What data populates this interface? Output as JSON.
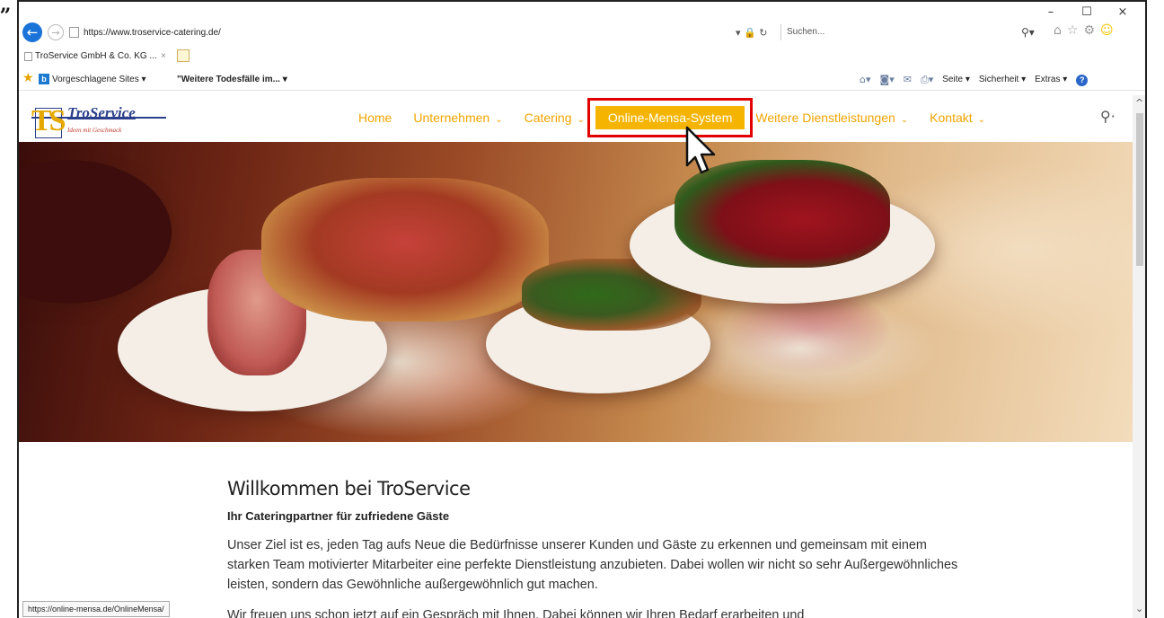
{
  "browser": {
    "url": "https://www.troservice-catering.de/",
    "search_placeholder": "Suchen...",
    "tab_title": "TroService GmbH & Co. KG ...",
    "tab_close": "×",
    "favorites": {
      "suggested": "Vorgeschlagene Sites ▾",
      "news": "\"Weitere Todesfälle im... ▾"
    },
    "commands": {
      "page": "Seite ▾",
      "security": "Sicherheit ▾",
      "extras": "Extras ▾",
      "help": "?"
    },
    "status_url": "https://online-mensa.de/OnlineMensa/"
  },
  "window": {
    "minimize": "–",
    "maximize": "☐",
    "close": "×"
  },
  "site": {
    "logo_letters": "TS",
    "brand": "TroService",
    "slogan": "Ideen mit Geschmack",
    "nav": {
      "home": "Home",
      "company": "Unternehmen",
      "catering": "Catering",
      "mensa": "Online-Mensa-System",
      "services": "Weitere Dienstleistungen",
      "contact": "Kontakt"
    },
    "welcome_title": "Willkommen bei TroService",
    "subtitle": "Ihr Cateringpartner für zufriedene Gäste",
    "paragraph1": "Unser Ziel ist es, jeden Tag aufs Neue die Bedürfnisse unserer Kunden und Gäste zu erkennen und gemeinsam mit einem starken Team motivierter Mitarbeiter eine perfekte Dienstleistung anzubieten. Dabei wollen wir nicht so sehr Außergewöhnliches leisten, sondern das Gewöhnliche außergewöhnlich gut machen.",
    "paragraph2": "Wir freuen uns schon jetzt auf ein Gespräch mit Ihnen. Dabei können wir Ihren Bedarf erarbeiten und"
  },
  "colors": {
    "accent": "#f4b400",
    "highlight_box": "#e00000",
    "brand_blue": "#2b3f8a"
  },
  "icons": [
    "back-arrow-icon",
    "forward-arrow-icon",
    "lock-icon",
    "refresh-icon",
    "search-icon",
    "home-icon",
    "favorites-star-icon",
    "settings-gear-icon",
    "smiley-icon",
    "rss-icon",
    "mail-icon",
    "print-icon",
    "help-icon",
    "chevron-down-icon",
    "mouse-cursor-icon"
  ]
}
